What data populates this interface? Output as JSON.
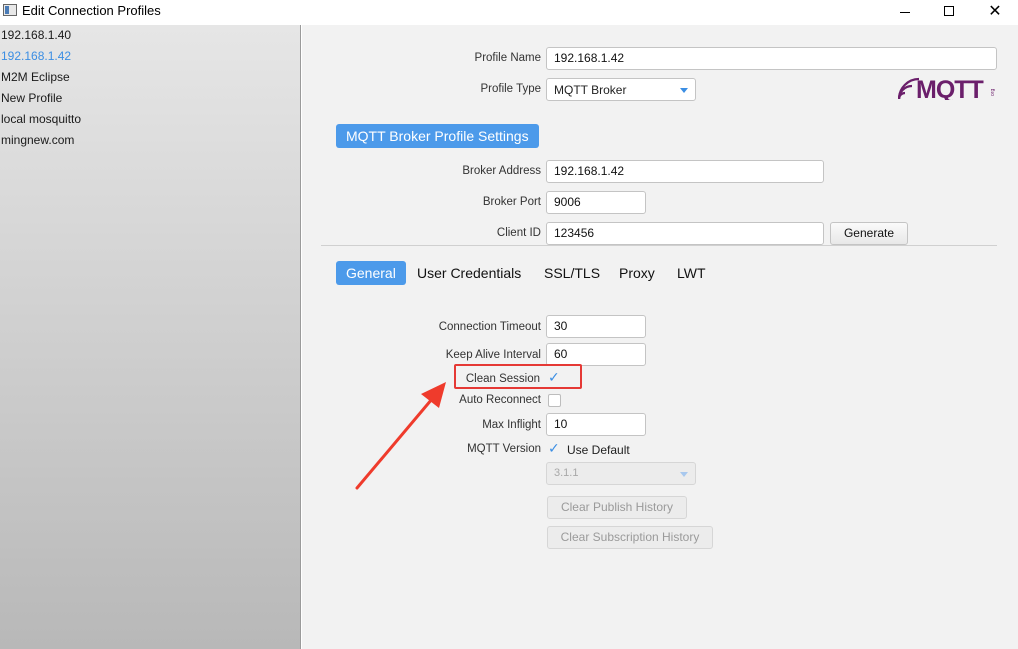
{
  "window": {
    "title": "Edit Connection Profiles",
    "controls": {
      "minimize": "",
      "maximize": "",
      "close": "✕"
    }
  },
  "sidebar": {
    "profiles": [
      {
        "label": "192.168.1.40",
        "selected": false
      },
      {
        "label": "192.168.1.42",
        "selected": true
      },
      {
        "label": "M2M Eclipse",
        "selected": false
      },
      {
        "label": "New Profile",
        "selected": false
      },
      {
        "label": "local mosquitto",
        "selected": false
      },
      {
        "label": "mingnew.com",
        "selected": false
      }
    ]
  },
  "profile": {
    "name_label": "Profile Name",
    "name_value": "192.168.1.42",
    "type_label": "Profile Type",
    "type_value": "MQTT Broker",
    "logo_text": "MQTT",
    "logo_suffix": "org"
  },
  "broker": {
    "section_title": "MQTT Broker Profile Settings",
    "address_label": "Broker Address",
    "address_value": "192.168.1.42",
    "port_label": "Broker Port",
    "port_value": "9006",
    "client_id_label": "Client ID",
    "client_id_value": "123456",
    "generate_label": "Generate"
  },
  "tabs": [
    {
      "label": "General",
      "active": true
    },
    {
      "label": "User Credentials",
      "active": false
    },
    {
      "label": "SSL/TLS",
      "active": false
    },
    {
      "label": "Proxy",
      "active": false
    },
    {
      "label": "LWT",
      "active": false
    }
  ],
  "general": {
    "connection_timeout_label": "Connection Timeout",
    "connection_timeout_value": "30",
    "keep_alive_label": "Keep Alive Interval",
    "keep_alive_value": "60",
    "clean_session_label": "Clean Session",
    "clean_session_checked": true,
    "auto_reconnect_label": "Auto Reconnect",
    "auto_reconnect_checked": false,
    "max_inflight_label": "Max Inflight",
    "max_inflight_value": "10",
    "mqtt_version_label": "MQTT Version",
    "use_default_label": "Use Default",
    "use_default_checked": true,
    "version_value": "3.1.1",
    "clear_publish_label": "Clear Publish History",
    "clear_subscription_label": "Clear Subscription History"
  },
  "colors": {
    "accent": "#4c9aea",
    "selected_text": "#3b8ee3",
    "highlight": "#e53935",
    "logo": "#6b1f6b"
  }
}
